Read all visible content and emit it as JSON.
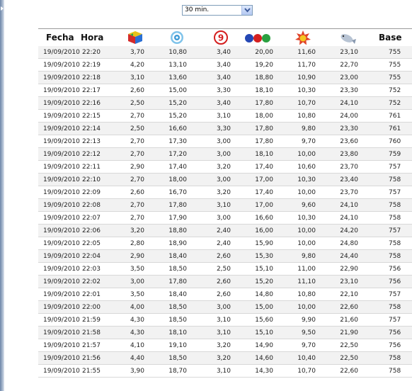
{
  "filter": {
    "selected": "30 min."
  },
  "table": {
    "headers": {
      "fecha": "Fecha",
      "hora": "Hora",
      "base": "Base"
    },
    "channels": [
      "canal-cubo-logo",
      "canal-circulo-logo",
      "canal-nueve-logo",
      "canal-tres-puntos-logo",
      "canal-estrella-logo",
      "canal-pez-logo"
    ],
    "rows": [
      {
        "fecha": "19/09/2010",
        "hora": "22:20",
        "v": [
          "3,70",
          "10,80",
          "3,40",
          "20,00",
          "11,60",
          "23,10"
        ],
        "base": "755"
      },
      {
        "fecha": "19/09/2010",
        "hora": "22:19",
        "v": [
          "4,20",
          "13,10",
          "3,40",
          "19,20",
          "11,70",
          "22,70"
        ],
        "base": "755"
      },
      {
        "fecha": "19/09/2010",
        "hora": "22:18",
        "v": [
          "3,10",
          "13,60",
          "3,40",
          "18,80",
          "10,90",
          "23,00"
        ],
        "base": "755"
      },
      {
        "fecha": "19/09/2010",
        "hora": "22:17",
        "v": [
          "2,60",
          "15,00",
          "3,30",
          "18,10",
          "10,30",
          "23,30"
        ],
        "base": "752"
      },
      {
        "fecha": "19/09/2010",
        "hora": "22:16",
        "v": [
          "2,50",
          "15,20",
          "3,40",
          "17,80",
          "10,70",
          "24,10"
        ],
        "base": "752"
      },
      {
        "fecha": "19/09/2010",
        "hora": "22:15",
        "v": [
          "2,70",
          "15,20",
          "3,10",
          "18,00",
          "10,80",
          "24,00"
        ],
        "base": "761"
      },
      {
        "fecha": "19/09/2010",
        "hora": "22:14",
        "v": [
          "2,50",
          "16,60",
          "3,30",
          "17,80",
          "9,80",
          "23,30"
        ],
        "base": "761"
      },
      {
        "fecha": "19/09/2010",
        "hora": "22:13",
        "v": [
          "2,70",
          "17,30",
          "3,00",
          "17,80",
          "9,70",
          "23,60"
        ],
        "base": "760"
      },
      {
        "fecha": "19/09/2010",
        "hora": "22:12",
        "v": [
          "2,70",
          "17,20",
          "3,00",
          "18,10",
          "10,00",
          "23,80"
        ],
        "base": "759"
      },
      {
        "fecha": "19/09/2010",
        "hora": "22:11",
        "v": [
          "2,90",
          "17,40",
          "3,20",
          "17,40",
          "10,60",
          "23,70"
        ],
        "base": "757"
      },
      {
        "fecha": "19/09/2010",
        "hora": "22:10",
        "v": [
          "2,70",
          "18,00",
          "3,00",
          "17,00",
          "10,30",
          "23,40"
        ],
        "base": "758"
      },
      {
        "fecha": "19/09/2010",
        "hora": "22:09",
        "v": [
          "2,60",
          "16,70",
          "3,20",
          "17,40",
          "10,00",
          "23,70"
        ],
        "base": "757"
      },
      {
        "fecha": "19/09/2010",
        "hora": "22:08",
        "v": [
          "2,70",
          "17,80",
          "3,10",
          "17,00",
          "9,60",
          "24,10"
        ],
        "base": "758"
      },
      {
        "fecha": "19/09/2010",
        "hora": "22:07",
        "v": [
          "2,70",
          "17,90",
          "3,00",
          "16,60",
          "10,30",
          "24,10"
        ],
        "base": "758"
      },
      {
        "fecha": "19/09/2010",
        "hora": "22:06",
        "v": [
          "3,20",
          "18,80",
          "2,40",
          "16,00",
          "10,00",
          "24,20"
        ],
        "base": "757"
      },
      {
        "fecha": "19/09/2010",
        "hora": "22:05",
        "v": [
          "2,80",
          "18,90",
          "2,40",
          "15,90",
          "10,00",
          "24,80"
        ],
        "base": "758"
      },
      {
        "fecha": "19/09/2010",
        "hora": "22:04",
        "v": [
          "2,90",
          "18,40",
          "2,60",
          "15,30",
          "9,80",
          "24,40"
        ],
        "base": "758"
      },
      {
        "fecha": "19/09/2010",
        "hora": "22:03",
        "v": [
          "3,50",
          "18,50",
          "2,50",
          "15,10",
          "11,00",
          "22,90"
        ],
        "base": "756"
      },
      {
        "fecha": "19/09/2010",
        "hora": "22:02",
        "v": [
          "3,00",
          "17,80",
          "2,60",
          "15,20",
          "11,10",
          "23,10"
        ],
        "base": "756"
      },
      {
        "fecha": "19/09/2010",
        "hora": "22:01",
        "v": [
          "3,50",
          "18,40",
          "2,60",
          "14,80",
          "10,80",
          "22,10"
        ],
        "base": "757"
      },
      {
        "fecha": "19/09/2010",
        "hora": "22:00",
        "v": [
          "4,00",
          "18,50",
          "3,00",
          "15,00",
          "10,00",
          "22,60"
        ],
        "base": "758"
      },
      {
        "fecha": "19/09/2010",
        "hora": "21:59",
        "v": [
          "4,30",
          "18,50",
          "3,10",
          "15,60",
          "9,90",
          "21,60"
        ],
        "base": "757"
      },
      {
        "fecha": "19/09/2010",
        "hora": "21:58",
        "v": [
          "4,30",
          "18,10",
          "3,10",
          "15,10",
          "9,50",
          "21,90"
        ],
        "base": "756"
      },
      {
        "fecha": "19/09/2010",
        "hora": "21:57",
        "v": [
          "4,10",
          "19,10",
          "3,20",
          "14,90",
          "9,70",
          "22,50"
        ],
        "base": "756"
      },
      {
        "fecha": "19/09/2010",
        "hora": "21:56",
        "v": [
          "4,40",
          "18,50",
          "3,20",
          "14,60",
          "10,40",
          "22,50"
        ],
        "base": "758"
      },
      {
        "fecha": "19/09/2010",
        "hora": "21:55",
        "v": [
          "3,90",
          "18,70",
          "3,10",
          "14,30",
          "10,70",
          "22,60"
        ],
        "base": "758"
      }
    ]
  }
}
